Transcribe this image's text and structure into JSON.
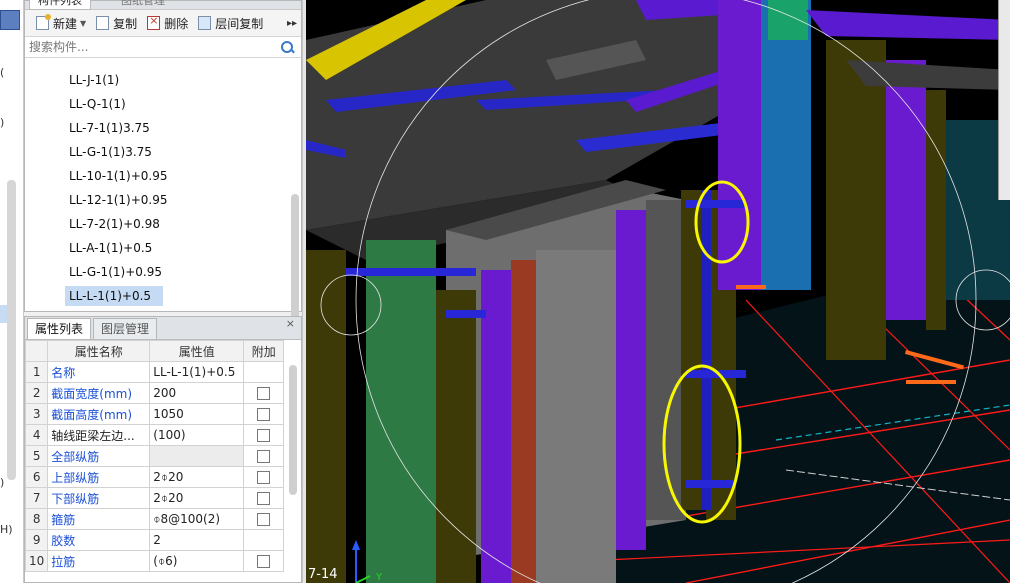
{
  "left_strip": {
    "glyphs": [
      "(",
      ")",
      ")",
      "H)"
    ]
  },
  "component_panel": {
    "tabs": [
      "构件列表",
      "图纸管理"
    ],
    "toolbar": {
      "new": "新建",
      "copy": "复制",
      "delete": "删除",
      "floor_copy": "层间复制",
      "more": "▸▸"
    },
    "search_placeholder": "搜索构件...",
    "items": [
      "LL-J-1(1)",
      "LL-Q-1(1)",
      "LL-7-1(1)3.75",
      "LL-G-1(1)3.75",
      "LL-10-1(1)+0.95",
      "LL-12-1(1)+0.95",
      "LL-7-2(1)+0.98",
      "LL-A-1(1)+0.5",
      "LL-G-1(1)+0.95",
      "LL-L-1(1)+0.5"
    ],
    "selected_index": 9
  },
  "property_panel": {
    "tabs": [
      "属性列表",
      "图层管理"
    ],
    "close": "×",
    "headers": [
      "属性名称",
      "属性值",
      "附加"
    ],
    "rows": [
      {
        "n": "1",
        "name": "名称",
        "value": "LL-L-1(1)+0.5",
        "blue": true,
        "check": false
      },
      {
        "n": "2",
        "name": "截面宽度(mm)",
        "value": "200",
        "blue": true,
        "check": true
      },
      {
        "n": "3",
        "name": "截面高度(mm)",
        "value": "1050",
        "blue": true,
        "check": true
      },
      {
        "n": "4",
        "name": "轴线距梁左边...",
        "value": "(100)",
        "blue": false,
        "check": true
      },
      {
        "n": "5",
        "name": "全部纵筋",
        "value": "",
        "blue": true,
        "check": true
      },
      {
        "n": "6",
        "name": "上部纵筋",
        "value": "2⌽20",
        "blue": true,
        "check": true
      },
      {
        "n": "7",
        "name": "下部纵筋",
        "value": "2⌽20",
        "blue": true,
        "check": true
      },
      {
        "n": "8",
        "name": "箍筋",
        "value": "⌽8@100(2)",
        "blue": true,
        "check": true
      },
      {
        "n": "9",
        "name": "胶数",
        "value": "2",
        "blue": true,
        "check": false
      },
      {
        "n": "10",
        "name": "拉筋",
        "value": "(⌽6)",
        "blue": true,
        "check": true
      }
    ]
  },
  "canvas": {
    "axis_label": "7-14",
    "axis_y": "Y",
    "colors": {
      "background": "#000000",
      "slab": "#3c3c3c",
      "column_olive": "#3e3b08",
      "beam_purple": "#6a1bd0",
      "beam_blue": "#2020c0",
      "highlight": "#f7f700"
    }
  }
}
